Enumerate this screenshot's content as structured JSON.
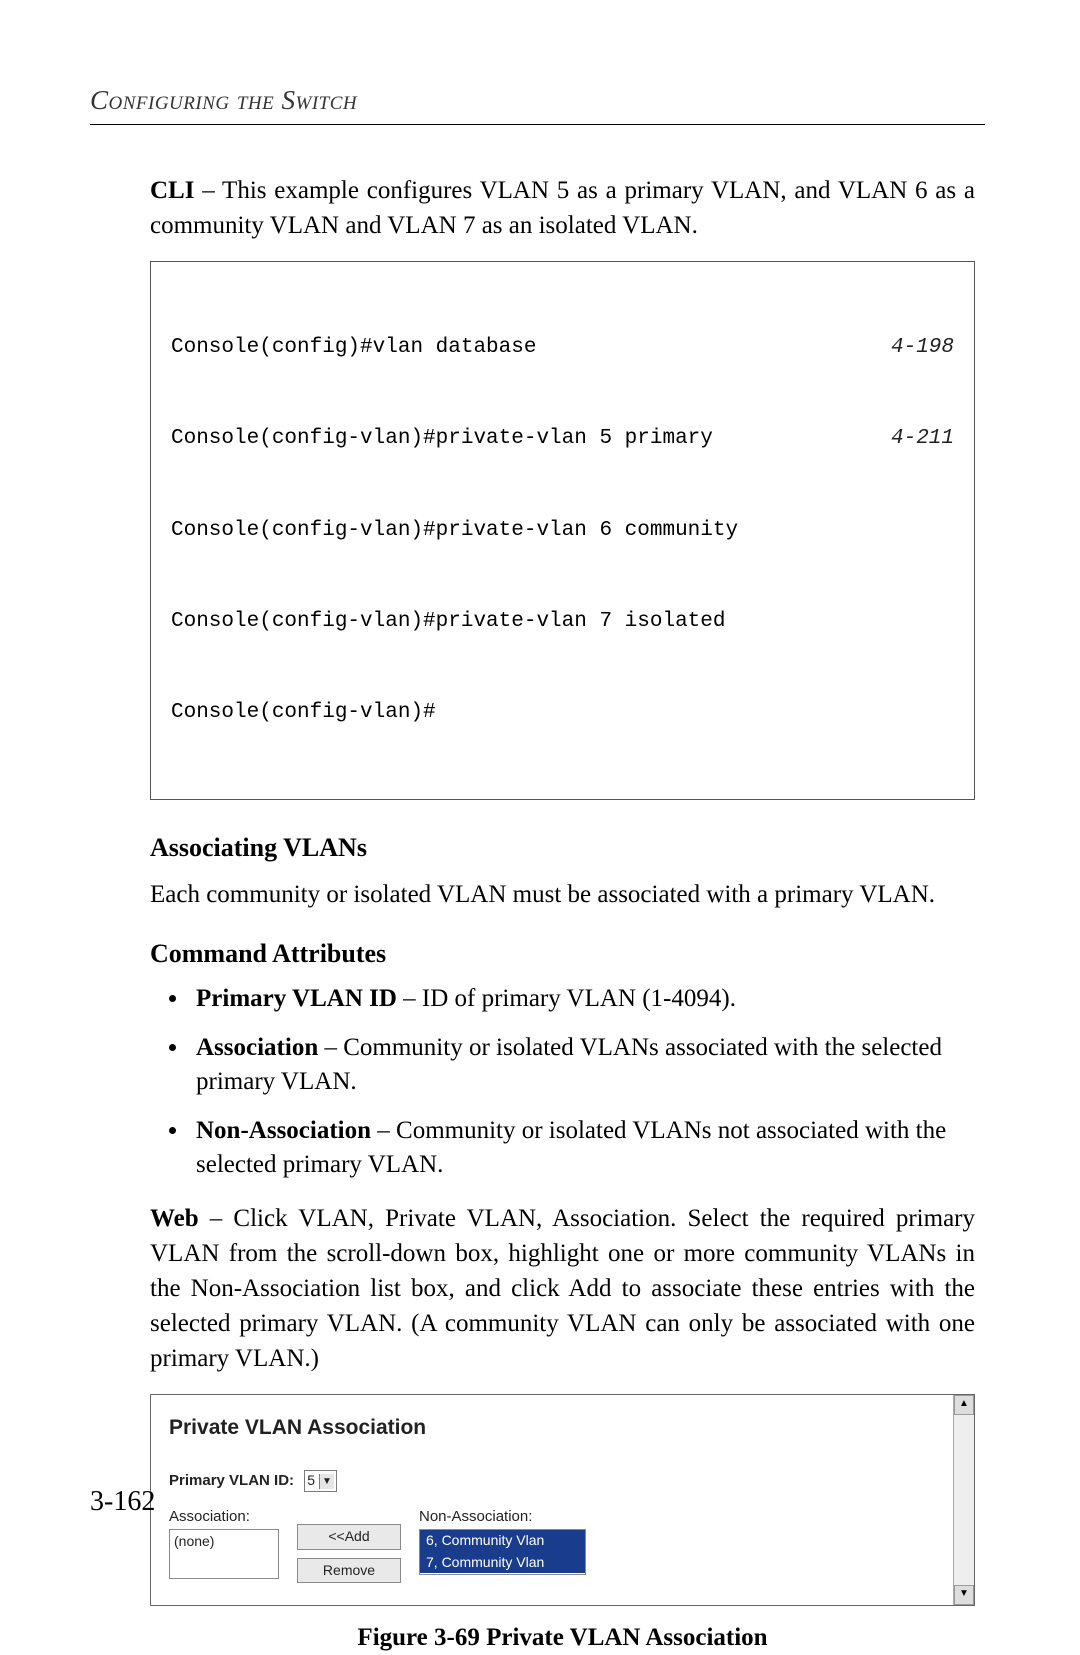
{
  "header": {
    "chapter": "Configuring the Switch"
  },
  "intro": {
    "cli_label": "CLI",
    "cli_text": " – This example configures VLAN 5 as a primary VLAN, and VLAN 6 as a community VLAN and VLAN 7 as an isolated VLAN."
  },
  "cli": {
    "lines": [
      {
        "cmd": "Console(config)#vlan database",
        "ref": "4-198"
      },
      {
        "cmd": "Console(config-vlan)#private-vlan 5 primary",
        "ref": "4-211"
      },
      {
        "cmd": "Console(config-vlan)#private-vlan 6 community",
        "ref": ""
      },
      {
        "cmd": "Console(config-vlan)#private-vlan 7 isolated",
        "ref": ""
      },
      {
        "cmd": "Console(config-vlan)#",
        "ref": ""
      }
    ]
  },
  "section1": {
    "title": "Associating VLANs",
    "para": "Each community or isolated VLAN must be associated with a primary VLAN."
  },
  "attrs": {
    "title": "Command Attributes",
    "items": [
      {
        "name": "Primary VLAN ID",
        "desc": " – ID of primary VLAN (1-4094)."
      },
      {
        "name": "Association",
        "desc": " – Community or isolated VLANs associated with the selected primary VLAN."
      },
      {
        "name": "Non-Association",
        "desc": " – Community or isolated VLANs not associated with the selected primary VLAN."
      }
    ]
  },
  "web": {
    "label": "Web",
    "text": " – Click VLAN, Private VLAN, Association. Select the required primary VLAN from the scroll-down box, highlight one or more community VLANs in the Non-Association list box, and click Add to associate these entries with the selected primary VLAN. (A community VLAN can only be associated with one primary VLAN.)"
  },
  "figure": {
    "title": "Private VLAN Association",
    "primary_label": "Primary VLAN ID:",
    "primary_value": "5",
    "assoc_label": "Association:",
    "assoc_value": "(none)",
    "nonassoc_label": "Non-Association:",
    "nonassoc_options": [
      "6, Community Vlan",
      "7, Community Vlan"
    ],
    "btn_add": "<<Add",
    "btn_remove": "Remove",
    "caption": "Figure 3-69  Private VLAN Association"
  },
  "page_number": "3-162"
}
